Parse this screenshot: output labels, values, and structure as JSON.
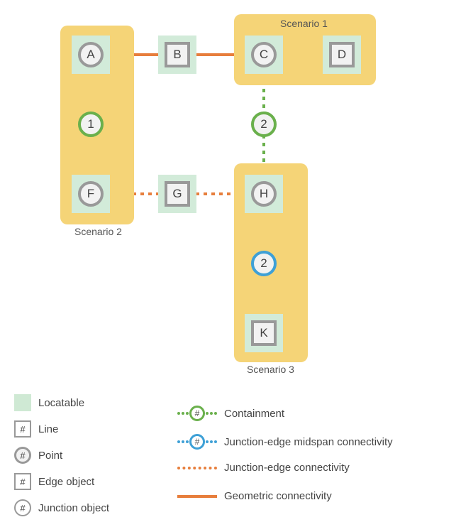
{
  "scenarios": {
    "s1": {
      "label": "Scenario 1"
    },
    "s2": {
      "label": "Scenario 2"
    },
    "s3": {
      "label": "Scenario 3"
    }
  },
  "nodes": {
    "A": "A",
    "B": "B",
    "C": "C",
    "D": "D",
    "n1": "1",
    "n2top": "2",
    "F": "F",
    "G": "G",
    "H": "H",
    "n2mid": "2",
    "K": "K"
  },
  "legend_left": {
    "locatable": "Locatable",
    "line": "Line",
    "point": "Point",
    "edge": "Edge object",
    "junction": "Junction object"
  },
  "legend_right": {
    "containment": "Containment",
    "midspan": "Junction-edge midspan connectivity",
    "jedge": "Junction-edge connectivity",
    "geom": "Geometric connectivity"
  },
  "hash": "#"
}
